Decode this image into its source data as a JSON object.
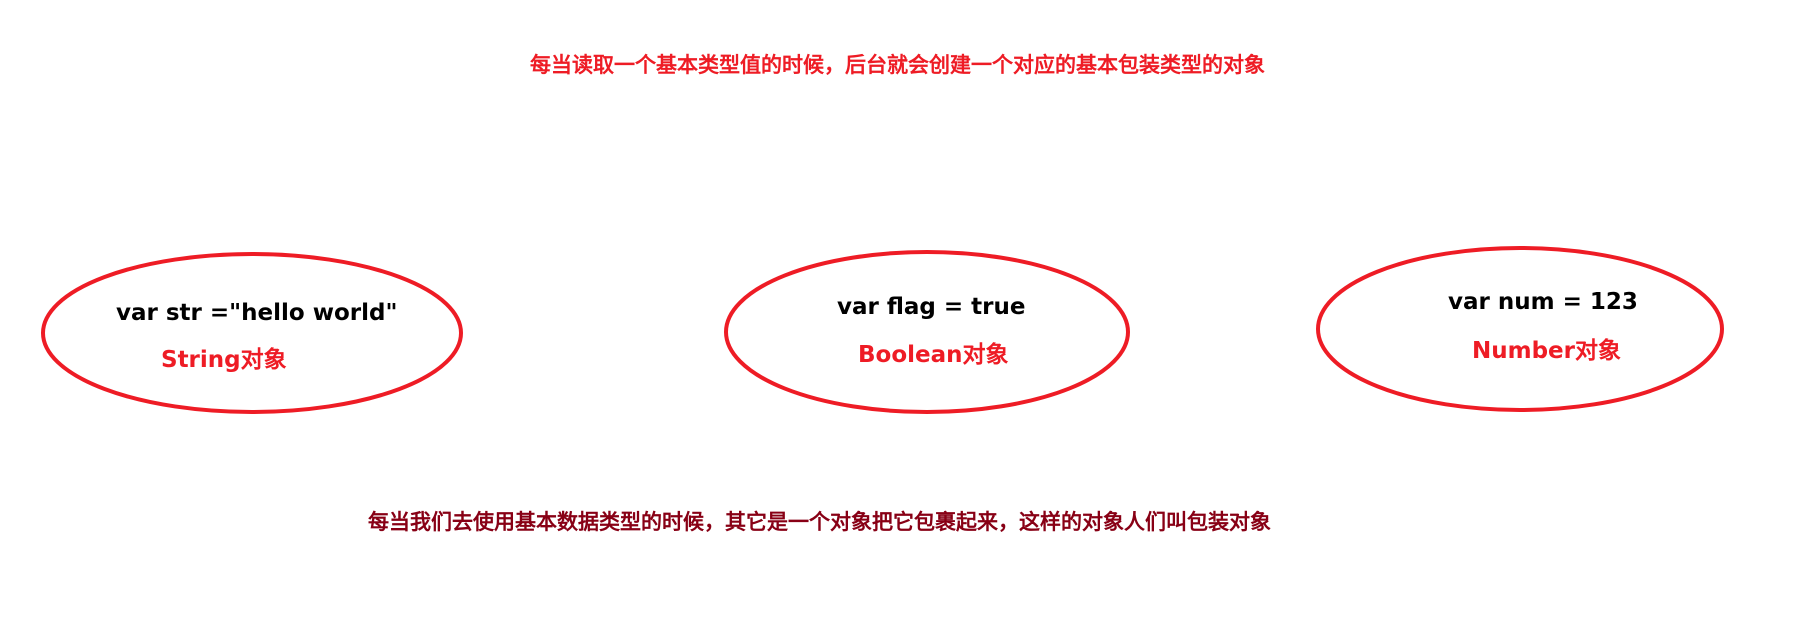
{
  "header": {
    "caption": "每当读取一个基本类型值的时候，后台就会创建一个对应的基本包装类型的对象"
  },
  "wrappers": [
    {
      "code": "var str  =\"hello world\"",
      "label": "String对象"
    },
    {
      "code": "var flag = true",
      "label": "Boolean对象"
    },
    {
      "code": "var num = 123",
      "label": "Number对象"
    }
  ],
  "footer": {
    "caption": "每当我们去使用基本数据类型的时候，其它是一个对象把它包裹起来，这样的对象人们叫包装对象"
  },
  "colors": {
    "accent": "#ee1c25",
    "footer_text": "#880015",
    "code_text": "#000000",
    "background": "#ffffff"
  }
}
